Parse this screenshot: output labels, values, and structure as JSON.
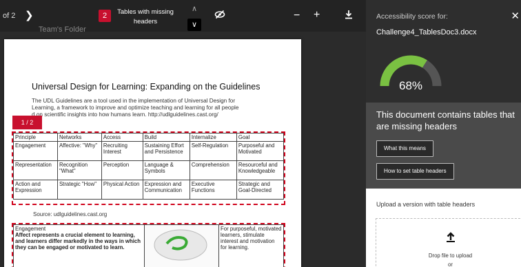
{
  "toolbar": {
    "page_counter": "of 2",
    "issue_count": "2",
    "issue_label": "Tables with missing headers",
    "prev_issue_icon": "chevron-up-icon",
    "next_issue_icon": "chevron-down-icon",
    "visibility_icon": "eye-off-icon",
    "zoom_out": "−",
    "zoom_in": "+",
    "download_icon": "download-icon"
  },
  "document": {
    "folder_label": "Team's Folder",
    "title": "Universal Design for Learning: Expanding on the Guidelines",
    "intro_line1": "The UDL Guidelines are a tool used in the implementation of Universal Design for",
    "intro_line2": "Learning, a framework to improve and optimize teaching and learning for all people",
    "intro_line3": "d on scientific insights into how humans learn. http://udlguidelines.cast.org/",
    "page_badge": "1 / 2",
    "table_rows": [
      [
        "Principle",
        "Networks",
        "Access",
        "Build",
        "Internalize",
        "Goal"
      ],
      [
        "Engagement",
        "Affective: \"Why\"",
        "Recruiting Interest",
        "Sustaining Effort and Persistence",
        "Self-Regulation",
        "Purposeful and Motivated"
      ],
      [
        "Representation",
        "Recognition \"What\"",
        "Perception",
        "Language & Symbols",
        "Comprehension",
        "Resourceful and Knowledgeable"
      ],
      [
        "Action and Expression",
        "Strategic \"How\"",
        "Physical Action",
        "Expression and Communication",
        "Executive Functions",
        "Strategic and Goal-Directed"
      ]
    ],
    "source": "Source: udlguidelines.cast.org",
    "engagement_heading": "Engagement",
    "engagement_text": "Affect represents a crucial element to learning, and learners differ markedly in the ways in which they can be engaged or motivated to learn.",
    "engagement_goal": "For purposeful, motivated learners, stimulate interest and motivation for learning."
  },
  "panel": {
    "score_label": "Accessibility score for:",
    "file_name": "Challenge4_TablesDoc3.docx",
    "score": 68,
    "score_text": "68%",
    "gauge_color": "#7ac142",
    "gauge_track_color": "#555555",
    "issue_message": "This document contains tables that are missing headers",
    "what_means_button": "What this means",
    "how_to_button": "How to set table headers",
    "close_icon": "close-icon",
    "upload_title": "Upload a version with table headers",
    "drop_text": "Drop file to upload",
    "drop_or": "or"
  },
  "colors": {
    "accent_red": "#c8102e",
    "panel_bg": "#2e2e2e",
    "message_bg": "#4a4a4a"
  }
}
